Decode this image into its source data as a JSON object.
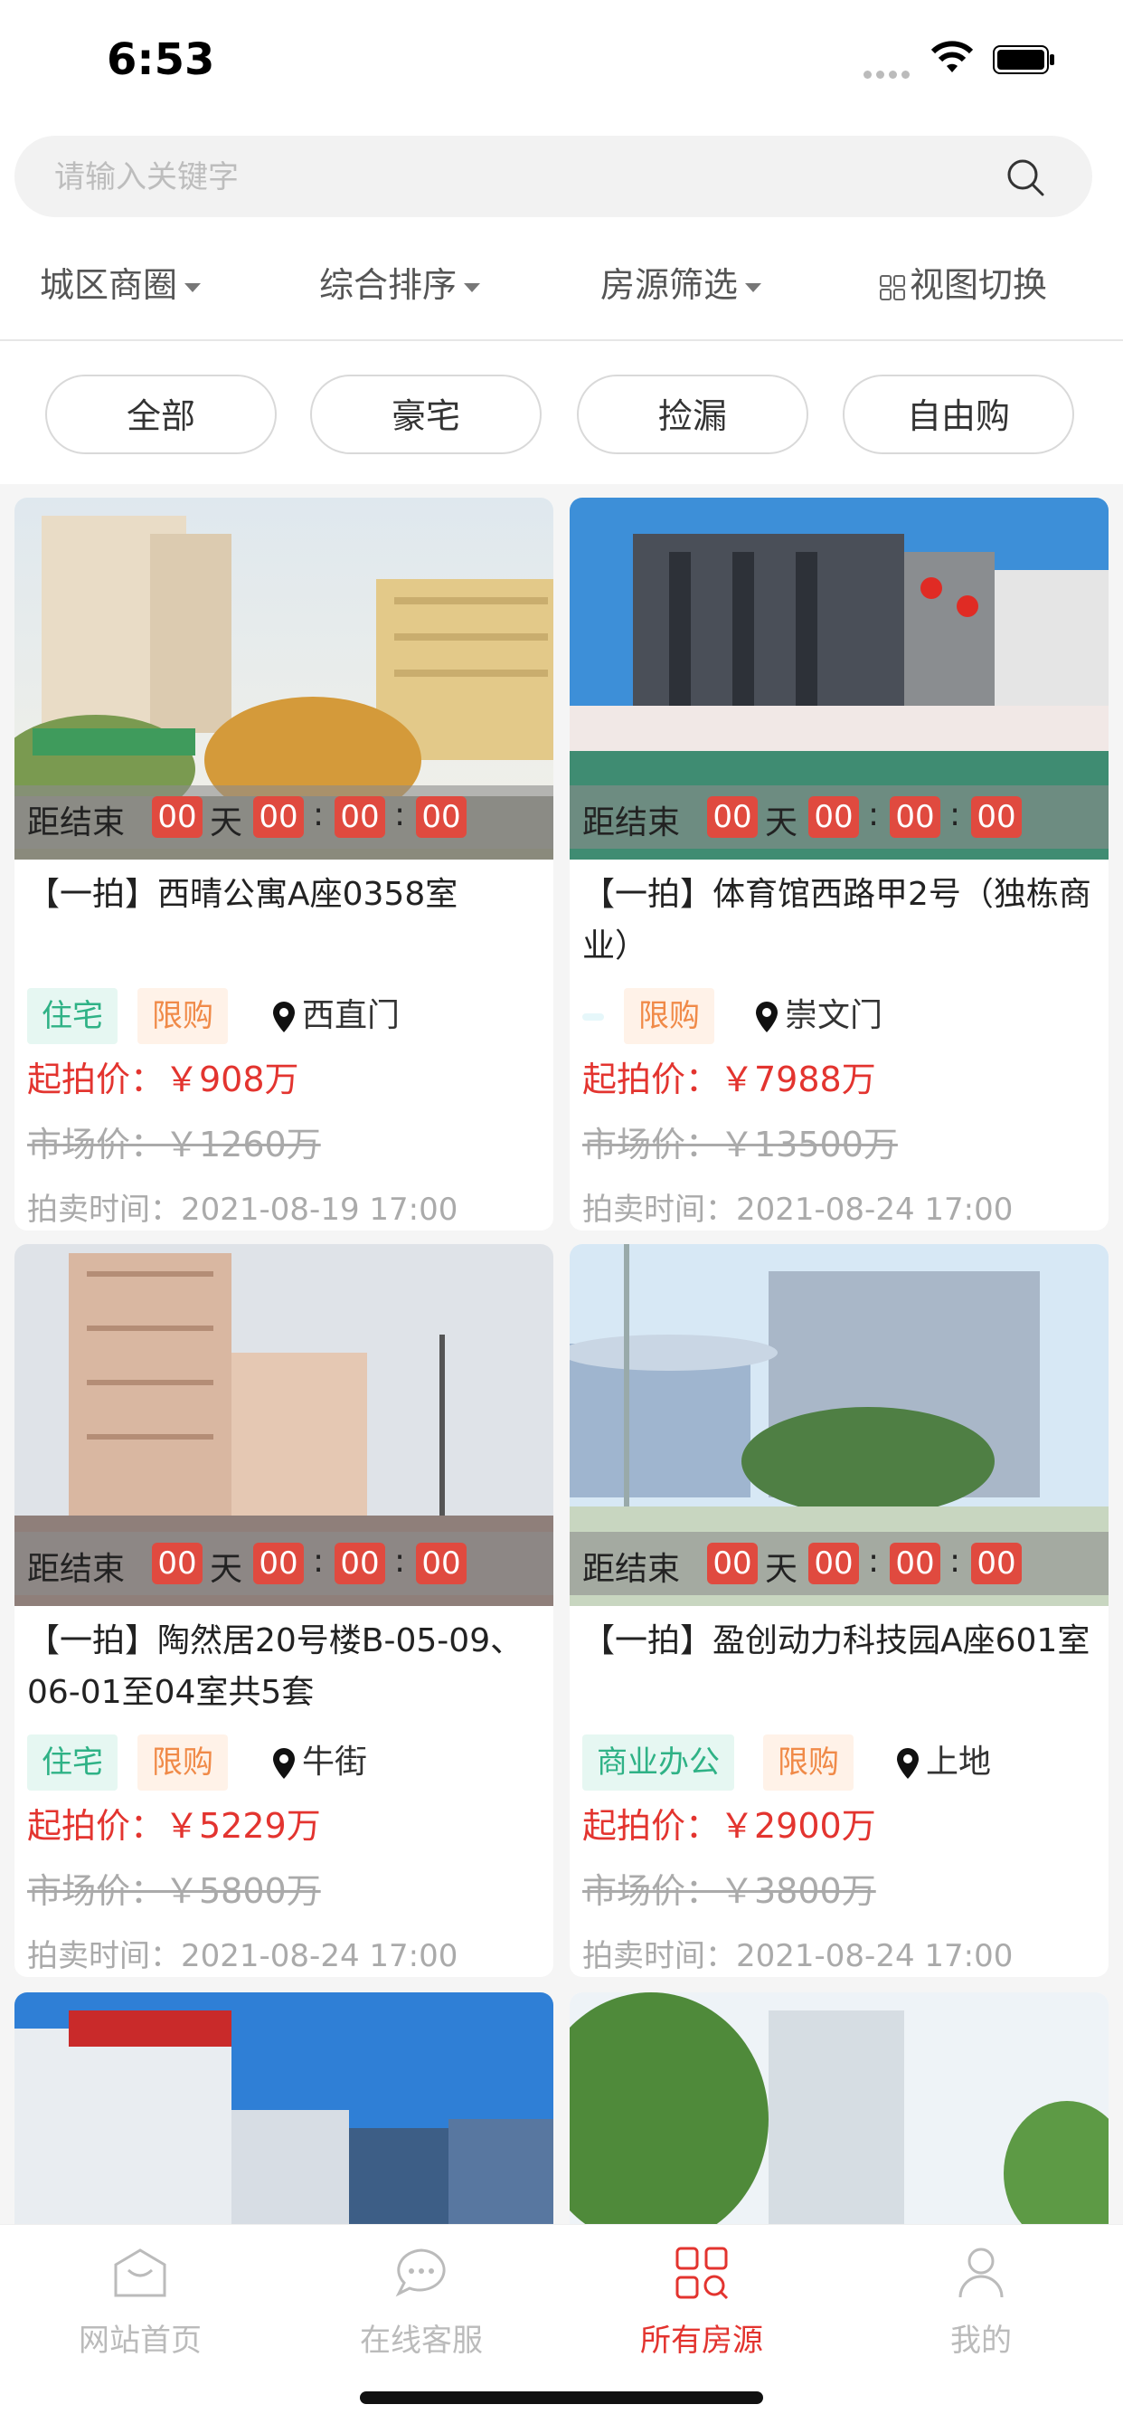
{
  "status_bar": {
    "time": "6:53"
  },
  "search": {
    "placeholder": "请输入关键字"
  },
  "filters": [
    {
      "label": "城区商圈",
      "icon": "caret-down-icon"
    },
    {
      "label": "综合排序",
      "icon": "caret-down-icon"
    },
    {
      "label": "房源筛选",
      "icon": "caret-down-icon"
    },
    {
      "label": "视图切换",
      "icon": "grid-icon"
    }
  ],
  "tabs": [
    "全部",
    "豪宅",
    "捡漏",
    "自由购"
  ],
  "countdown": {
    "label": "距结束",
    "days": "00",
    "day_unit": "天",
    "hours": "00",
    "minutes": "00",
    "seconds": "00",
    "sep": ":"
  },
  "listings": [
    {
      "title": "【一拍】西晴公寓A座0358室",
      "tags": [
        "住宅",
        "限购"
      ],
      "location": "西直门",
      "start_price": "起拍价：￥908万",
      "market_price": "市场价：￥1260万",
      "auction_time": "拍卖时间：2021-08-19 17:00"
    },
    {
      "title": "【一拍】体育馆西路甲2号（独栋商业）",
      "tags": [
        "",
        "限购"
      ],
      "location": "崇文门",
      "start_price": "起拍价：￥7988万",
      "market_price": "市场价：￥13500万",
      "auction_time": "拍卖时间：2021-08-24 17:00"
    },
    {
      "title": "【一拍】陶然居20号楼B-05-09、06-01至04室共5套",
      "tags": [
        "住宅",
        "限购"
      ],
      "location": "牛街",
      "start_price": "起拍价：￥5229万",
      "market_price": "市场价：￥5800万",
      "auction_time": "拍卖时间：2021-08-24 17:00"
    },
    {
      "title": "【一拍】盈创动力科技园A座601室",
      "tags": [
        "商业办公",
        "限购"
      ],
      "location": "上地",
      "start_price": "起拍价：￥2900万",
      "market_price": "市场价：￥3800万",
      "auction_time": "拍卖时间：2021-08-24 17:00"
    }
  ],
  "bottom_nav": [
    {
      "label": "网站首页",
      "icon": "home-icon",
      "active": false
    },
    {
      "label": "在线客服",
      "icon": "chat-icon",
      "active": false
    },
    {
      "label": "所有房源",
      "icon": "grid-icon",
      "active": true
    },
    {
      "label": "我的",
      "icon": "user-icon",
      "active": false
    }
  ],
  "colors": {
    "accent": "#e3342f",
    "countdown_box": "#e04a3f",
    "tag_green": "#2fb286",
    "tag_orange": "#f08a48"
  }
}
